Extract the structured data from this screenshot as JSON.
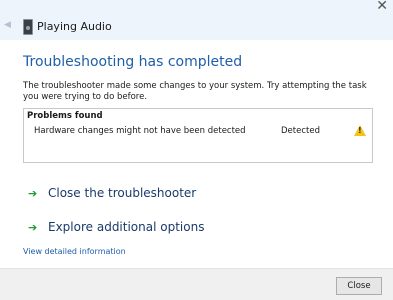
{
  "window": {
    "title": "Playing Audio",
    "back_glyph": "◀",
    "close_glyph": "✕",
    "app_icon": "speaker-icon"
  },
  "main": {
    "heading": "Troubleshooting has completed",
    "description": "The troubleshooter made some changes to your system. Try attempting the task you were trying to do before.",
    "problems": {
      "title": "Problems found",
      "items": [
        {
          "text": "Hardware changes might not have been detected",
          "status": "Detected",
          "icon": "warning-icon"
        }
      ]
    },
    "actions": [
      {
        "label": "Close the troubleshooter",
        "icon": "green-arrow-icon"
      },
      {
        "label": "Explore additional options",
        "icon": "green-arrow-icon"
      }
    ],
    "detail_link": "View detailed information"
  },
  "footer": {
    "close_label": "Close"
  },
  "colors": {
    "heading": "#1f5fa8",
    "arrow": "#1d9a31",
    "warning": "#f3c316",
    "titlebar": "#eef4fb"
  }
}
